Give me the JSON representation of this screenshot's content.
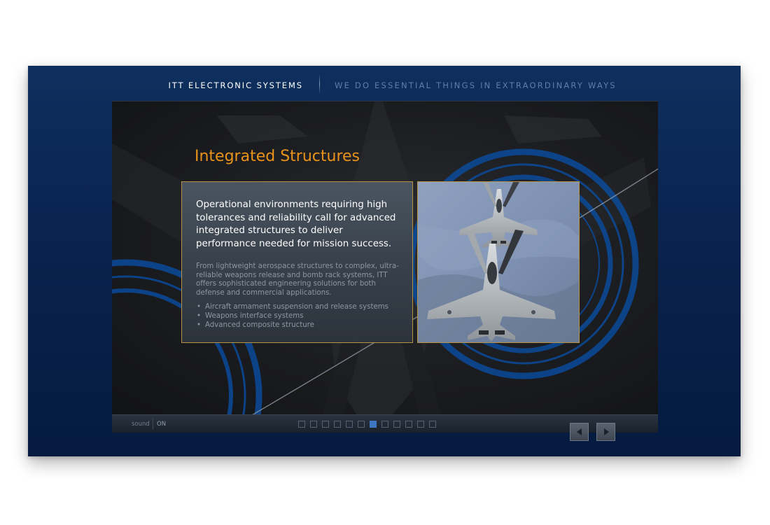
{
  "header": {
    "brand": "ITT ELECTRONIC SYSTEMS",
    "tagline": "WE DO ESSENTIAL THINGS IN EXTRAORDINARY WAYS"
  },
  "slide": {
    "title": "Integrated Structures",
    "lead": "Operational environments requiring high tolerances and reliability call for advanced integrated structures to deliver performance needed for mission success.",
    "body": "From lightweight aerospace structures to complex, ultra-reliable weapons release and bomb rack systems, ITT offers sophisticated engineering solutions for both defense and commercial applications.",
    "bullets": [
      "Aircraft armament suspension and release systems",
      "Weapons interface systems",
      "Advanced composite structure"
    ],
    "photo_icon": "fighter-jets-photo"
  },
  "footer": {
    "sound_label": "sound",
    "sound_state": "ON",
    "page_count": 12,
    "active_page": 7,
    "prev_icon": "arrow-left-icon",
    "next_icon": "arrow-right-icon"
  },
  "colors": {
    "accent": "#e8931c",
    "frame": "#0a2450",
    "pager_active": "#3f76c2",
    "card_border": "#b89244"
  }
}
